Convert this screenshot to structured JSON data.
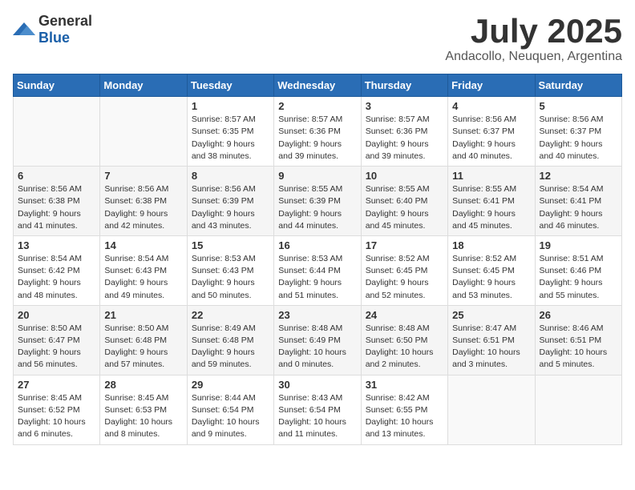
{
  "logo": {
    "general": "General",
    "blue": "Blue"
  },
  "title": "July 2025",
  "subtitle": "Andacollo, Neuquen, Argentina",
  "weekdays": [
    "Sunday",
    "Monday",
    "Tuesday",
    "Wednesday",
    "Thursday",
    "Friday",
    "Saturday"
  ],
  "weeks": [
    [
      {
        "day": "",
        "sunrise": "",
        "sunset": "",
        "daylight": ""
      },
      {
        "day": "",
        "sunrise": "",
        "sunset": "",
        "daylight": ""
      },
      {
        "day": "1",
        "sunrise": "Sunrise: 8:57 AM",
        "sunset": "Sunset: 6:35 PM",
        "daylight": "Daylight: 9 hours and 38 minutes."
      },
      {
        "day": "2",
        "sunrise": "Sunrise: 8:57 AM",
        "sunset": "Sunset: 6:36 PM",
        "daylight": "Daylight: 9 hours and 39 minutes."
      },
      {
        "day": "3",
        "sunrise": "Sunrise: 8:57 AM",
        "sunset": "Sunset: 6:36 PM",
        "daylight": "Daylight: 9 hours and 39 minutes."
      },
      {
        "day": "4",
        "sunrise": "Sunrise: 8:56 AM",
        "sunset": "Sunset: 6:37 PM",
        "daylight": "Daylight: 9 hours and 40 minutes."
      },
      {
        "day": "5",
        "sunrise": "Sunrise: 8:56 AM",
        "sunset": "Sunset: 6:37 PM",
        "daylight": "Daylight: 9 hours and 40 minutes."
      }
    ],
    [
      {
        "day": "6",
        "sunrise": "Sunrise: 8:56 AM",
        "sunset": "Sunset: 6:38 PM",
        "daylight": "Daylight: 9 hours and 41 minutes."
      },
      {
        "day": "7",
        "sunrise": "Sunrise: 8:56 AM",
        "sunset": "Sunset: 6:38 PM",
        "daylight": "Daylight: 9 hours and 42 minutes."
      },
      {
        "day": "8",
        "sunrise": "Sunrise: 8:56 AM",
        "sunset": "Sunset: 6:39 PM",
        "daylight": "Daylight: 9 hours and 43 minutes."
      },
      {
        "day": "9",
        "sunrise": "Sunrise: 8:55 AM",
        "sunset": "Sunset: 6:39 PM",
        "daylight": "Daylight: 9 hours and 44 minutes."
      },
      {
        "day": "10",
        "sunrise": "Sunrise: 8:55 AM",
        "sunset": "Sunset: 6:40 PM",
        "daylight": "Daylight: 9 hours and 45 minutes."
      },
      {
        "day": "11",
        "sunrise": "Sunrise: 8:55 AM",
        "sunset": "Sunset: 6:41 PM",
        "daylight": "Daylight: 9 hours and 45 minutes."
      },
      {
        "day": "12",
        "sunrise": "Sunrise: 8:54 AM",
        "sunset": "Sunset: 6:41 PM",
        "daylight": "Daylight: 9 hours and 46 minutes."
      }
    ],
    [
      {
        "day": "13",
        "sunrise": "Sunrise: 8:54 AM",
        "sunset": "Sunset: 6:42 PM",
        "daylight": "Daylight: 9 hours and 48 minutes."
      },
      {
        "day": "14",
        "sunrise": "Sunrise: 8:54 AM",
        "sunset": "Sunset: 6:43 PM",
        "daylight": "Daylight: 9 hours and 49 minutes."
      },
      {
        "day": "15",
        "sunrise": "Sunrise: 8:53 AM",
        "sunset": "Sunset: 6:43 PM",
        "daylight": "Daylight: 9 hours and 50 minutes."
      },
      {
        "day": "16",
        "sunrise": "Sunrise: 8:53 AM",
        "sunset": "Sunset: 6:44 PM",
        "daylight": "Daylight: 9 hours and 51 minutes."
      },
      {
        "day": "17",
        "sunrise": "Sunrise: 8:52 AM",
        "sunset": "Sunset: 6:45 PM",
        "daylight": "Daylight: 9 hours and 52 minutes."
      },
      {
        "day": "18",
        "sunrise": "Sunrise: 8:52 AM",
        "sunset": "Sunset: 6:45 PM",
        "daylight": "Daylight: 9 hours and 53 minutes."
      },
      {
        "day": "19",
        "sunrise": "Sunrise: 8:51 AM",
        "sunset": "Sunset: 6:46 PM",
        "daylight": "Daylight: 9 hours and 55 minutes."
      }
    ],
    [
      {
        "day": "20",
        "sunrise": "Sunrise: 8:50 AM",
        "sunset": "Sunset: 6:47 PM",
        "daylight": "Daylight: 9 hours and 56 minutes."
      },
      {
        "day": "21",
        "sunrise": "Sunrise: 8:50 AM",
        "sunset": "Sunset: 6:48 PM",
        "daylight": "Daylight: 9 hours and 57 minutes."
      },
      {
        "day": "22",
        "sunrise": "Sunrise: 8:49 AM",
        "sunset": "Sunset: 6:48 PM",
        "daylight": "Daylight: 9 hours and 59 minutes."
      },
      {
        "day": "23",
        "sunrise": "Sunrise: 8:48 AM",
        "sunset": "Sunset: 6:49 PM",
        "daylight": "Daylight: 10 hours and 0 minutes."
      },
      {
        "day": "24",
        "sunrise": "Sunrise: 8:48 AM",
        "sunset": "Sunset: 6:50 PM",
        "daylight": "Daylight: 10 hours and 2 minutes."
      },
      {
        "day": "25",
        "sunrise": "Sunrise: 8:47 AM",
        "sunset": "Sunset: 6:51 PM",
        "daylight": "Daylight: 10 hours and 3 minutes."
      },
      {
        "day": "26",
        "sunrise": "Sunrise: 8:46 AM",
        "sunset": "Sunset: 6:51 PM",
        "daylight": "Daylight: 10 hours and 5 minutes."
      }
    ],
    [
      {
        "day": "27",
        "sunrise": "Sunrise: 8:45 AM",
        "sunset": "Sunset: 6:52 PM",
        "daylight": "Daylight: 10 hours and 6 minutes."
      },
      {
        "day": "28",
        "sunrise": "Sunrise: 8:45 AM",
        "sunset": "Sunset: 6:53 PM",
        "daylight": "Daylight: 10 hours and 8 minutes."
      },
      {
        "day": "29",
        "sunrise": "Sunrise: 8:44 AM",
        "sunset": "Sunset: 6:54 PM",
        "daylight": "Daylight: 10 hours and 9 minutes."
      },
      {
        "day": "30",
        "sunrise": "Sunrise: 8:43 AM",
        "sunset": "Sunset: 6:54 PM",
        "daylight": "Daylight: 10 hours and 11 minutes."
      },
      {
        "day": "31",
        "sunrise": "Sunrise: 8:42 AM",
        "sunset": "Sunset: 6:55 PM",
        "daylight": "Daylight: 10 hours and 13 minutes."
      },
      {
        "day": "",
        "sunrise": "",
        "sunset": "",
        "daylight": ""
      },
      {
        "day": "",
        "sunrise": "",
        "sunset": "",
        "daylight": ""
      }
    ]
  ]
}
